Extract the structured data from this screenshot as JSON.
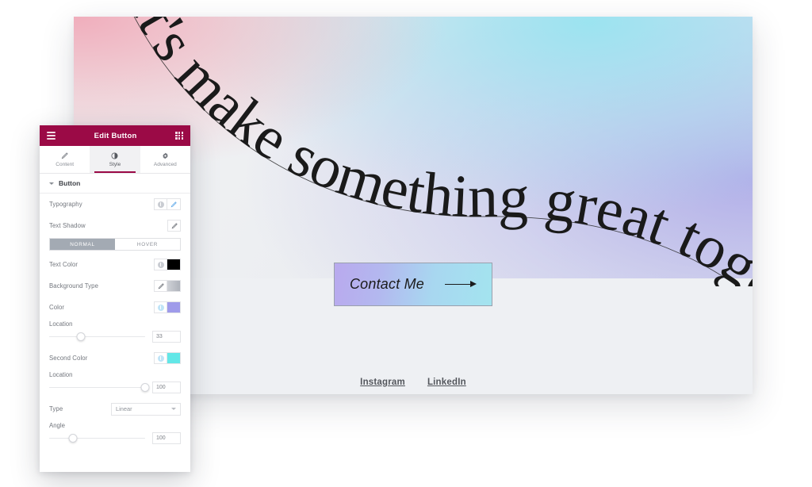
{
  "preview": {
    "headline": "let's make something great together",
    "cta": {
      "label": "Contact Me",
      "arrow_icon": "arrow-right-icon"
    },
    "footer_links": [
      {
        "label": "Instagram"
      },
      {
        "label": "LinkedIn"
      }
    ],
    "colors": {
      "gradient_pink": "#f0aab9",
      "gradient_cyan": "#96e4f0",
      "gradient_purple": "#aface8",
      "canvas": "#eef0f3",
      "button_start": "#b9a9ee",
      "button_end": "#a3e4ef"
    }
  },
  "panel": {
    "header": {
      "title": "Edit Button",
      "menu_icon": "hamburger-icon",
      "apps_icon": "grid-apps-icon",
      "accent_color": "#9b0a46"
    },
    "tabs": [
      {
        "label": "Content",
        "icon": "pencil-icon",
        "active": false
      },
      {
        "label": "Style",
        "icon": "contrast-icon",
        "active": true
      },
      {
        "label": "Advanced",
        "icon": "gear-icon",
        "active": false
      }
    ],
    "section": {
      "title": "Button",
      "collapsed": false
    },
    "controls": {
      "typography": {
        "label": "Typography",
        "globe_icon": "globe-icon",
        "edit_icon": "pencil-icon"
      },
      "text_shadow": {
        "label": "Text Shadow",
        "edit_icon": "pencil-icon"
      },
      "state_toggle": {
        "normal": "NORMAL",
        "hover": "HOVER",
        "active": "NORMAL"
      },
      "text_color": {
        "label": "Text Color",
        "globe_icon": "globe-icon",
        "value": "#000000"
      },
      "background_type": {
        "label": "Background Type",
        "classic_icon": "brush-icon",
        "gradient_icon": "gradient-icon",
        "active": "gradient"
      },
      "color": {
        "label": "Color",
        "globe_icon": "globe-icon",
        "value": "#9f9bea"
      },
      "color_location": {
        "label": "Location",
        "value": "33",
        "percent": 33
      },
      "second_color": {
        "label": "Second Color",
        "globe_icon": "globe-icon",
        "value": "#62e7e7"
      },
      "second_location": {
        "label": "Location",
        "value": "100",
        "percent": 100
      },
      "type": {
        "label": "Type",
        "value": "Linear",
        "chevron_icon": "chevron-down-icon"
      },
      "angle": {
        "label": "Angle",
        "value": "100",
        "percent": 25
      }
    }
  }
}
